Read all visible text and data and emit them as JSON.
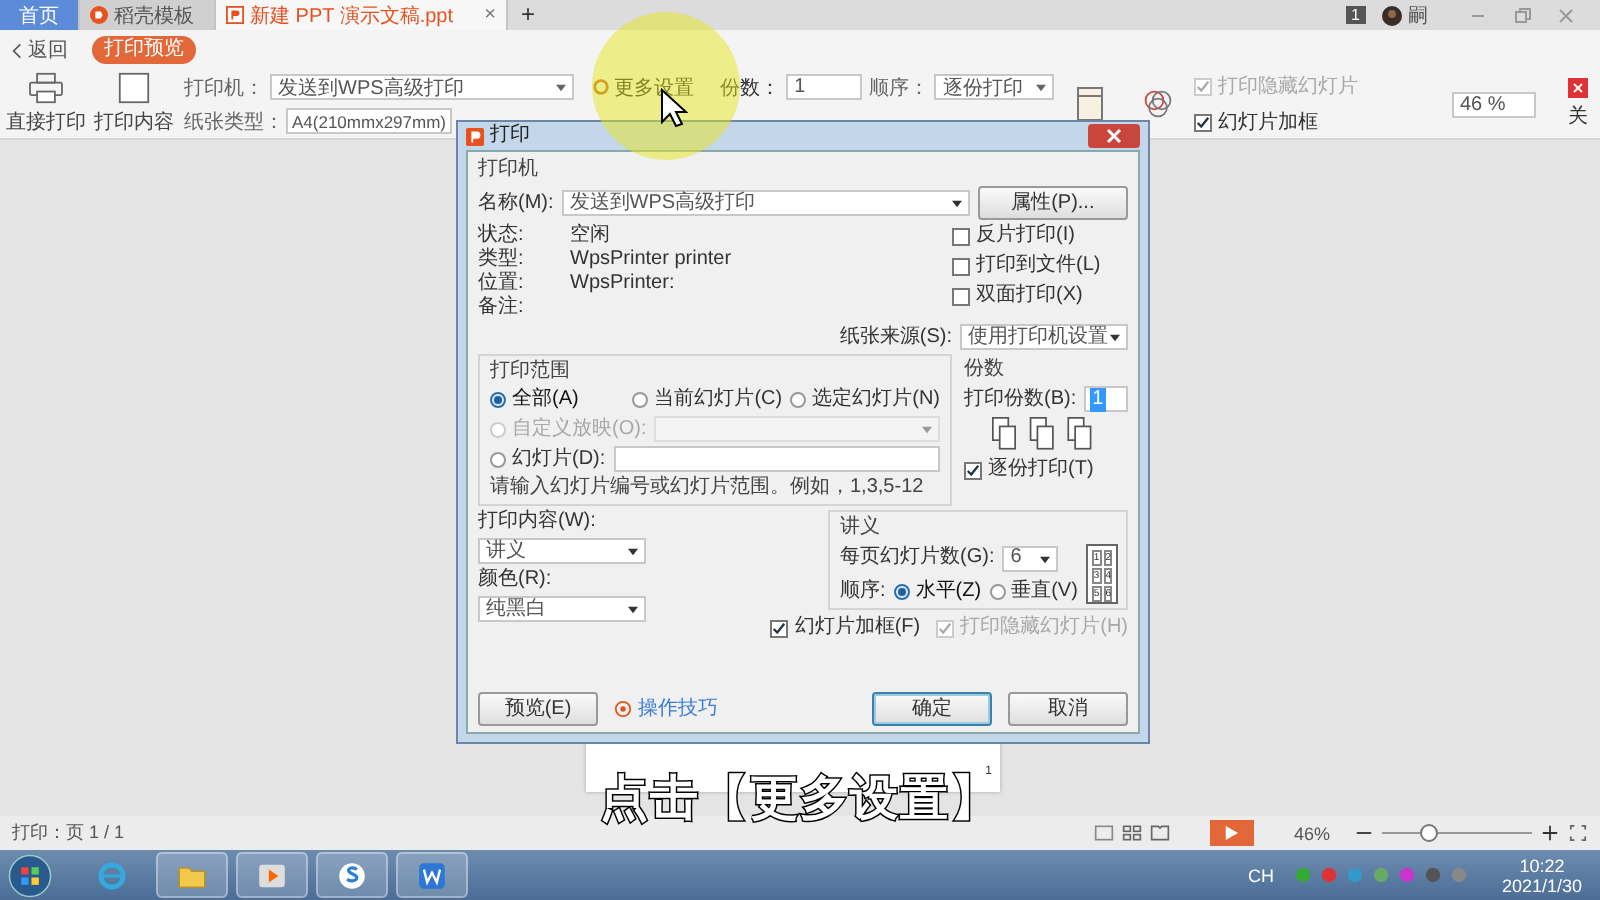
{
  "tabs": [
    {
      "label": "首页",
      "selected": false,
      "kind": "home"
    },
    {
      "label": "稻壳模板",
      "selected": false,
      "kind": "template"
    },
    {
      "label": "新建 PPT 演示文稿.ppt",
      "selected": true,
      "kind": "document",
      "close": "×"
    }
  ],
  "new_tab": "+",
  "account": {
    "badge": "1",
    "name": "嗣"
  },
  "toolbar": {
    "back": "返回",
    "mode": "打印预览",
    "actions": [
      {
        "label": "直接打印",
        "kind": "printer"
      },
      {
        "label": "打印内容",
        "kind": "frame"
      }
    ],
    "printer": {
      "label": "打印机：",
      "value": "发送到WPS高级打印"
    },
    "paper": {
      "label": "纸张类型：",
      "value": "A4(210mmx297mm)"
    },
    "more": "更多设置",
    "copies": {
      "label": "份数：",
      "value": "1"
    },
    "order": {
      "label": "顺序：",
      "value": "逐份打印"
    },
    "options": [
      {
        "label": "打印隐藏幻灯片",
        "checked": true,
        "disabled": true
      },
      {
        "label": "幻灯片加框",
        "checked": true,
        "disabled": false
      }
    ],
    "zoom": "46 %",
    "close": "关"
  },
  "dialog": {
    "title": "打印",
    "printer_title": "打印机",
    "name_label": "名称(M):",
    "name_value": "发送到WPS高级打印",
    "properties": "属性(P)...",
    "info": [
      {
        "label": "状态:",
        "value": "空闲"
      },
      {
        "label": "类型:",
        "value": "WpsPrinter printer"
      },
      {
        "label": "位置:",
        "value": "WpsPrinter:"
      },
      {
        "label": "备注:"
      }
    ],
    "printer_options": [
      {
        "label": "反片打印(I)",
        "checked": false
      },
      {
        "label": "打印到文件(L)",
        "checked": false
      },
      {
        "label": "双面打印(X)",
        "checked": false
      }
    ],
    "source_label": "纸张来源(S):",
    "source_value": "使用打印机设置",
    "range": {
      "title": "打印范围",
      "options": [
        {
          "label": "全部(A)",
          "selected": true
        },
        {
          "label": "当前幻灯片(C)",
          "selected": false
        },
        {
          "label": "选定幻灯片(N)",
          "selected": false
        }
      ],
      "custom": {
        "label": "自定义放映(O):",
        "selected": false,
        "disabled": true
      },
      "slides": {
        "label": "幻灯片(D):",
        "selected": false
      },
      "hint": "请输入幻灯片编号或幻灯片范围。例如，1,3,5-12"
    },
    "copies": {
      "title": "份数",
      "label": "打印份数(B):",
      "value": "1",
      "collate": {
        "label": "逐份打印(T)",
        "checked": true
      }
    },
    "content": {
      "label": "打印内容(W):",
      "value": "讲义"
    },
    "color": {
      "label": "颜色(R):",
      "value": "纯黑白"
    },
    "handout": {
      "title": "讲义",
      "per_page_label": "每页幻灯片数(G):",
      "per_page": "6",
      "order_label": "顺序:",
      "orders": [
        {
          "label": "水平(Z)",
          "selected": true
        },
        {
          "label": "垂直(V)",
          "selected": false
        }
      ],
      "layout": [
        "1",
        "2",
        "3",
        "4",
        "5",
        "6"
      ]
    },
    "checks": [
      {
        "label": "幻灯片加框(F)",
        "checked": true,
        "disabled": false
      },
      {
        "label": "打印隐藏幻灯片(H)",
        "checked": true,
        "disabled": true
      }
    ],
    "preview": "预览(E)",
    "tips": "操作技巧",
    "ok": "确定",
    "cancel": "取消"
  },
  "page_number": "1",
  "status_bar": {
    "page": "打印：页 1 / 1",
    "zoom": "46%",
    "zoom_slider": {
      "level": 0.3
    }
  },
  "taskbar": {
    "language": "CH",
    "time": "10:22",
    "date": "2021/1/30"
  },
  "caption": "点击【更多设置】"
}
